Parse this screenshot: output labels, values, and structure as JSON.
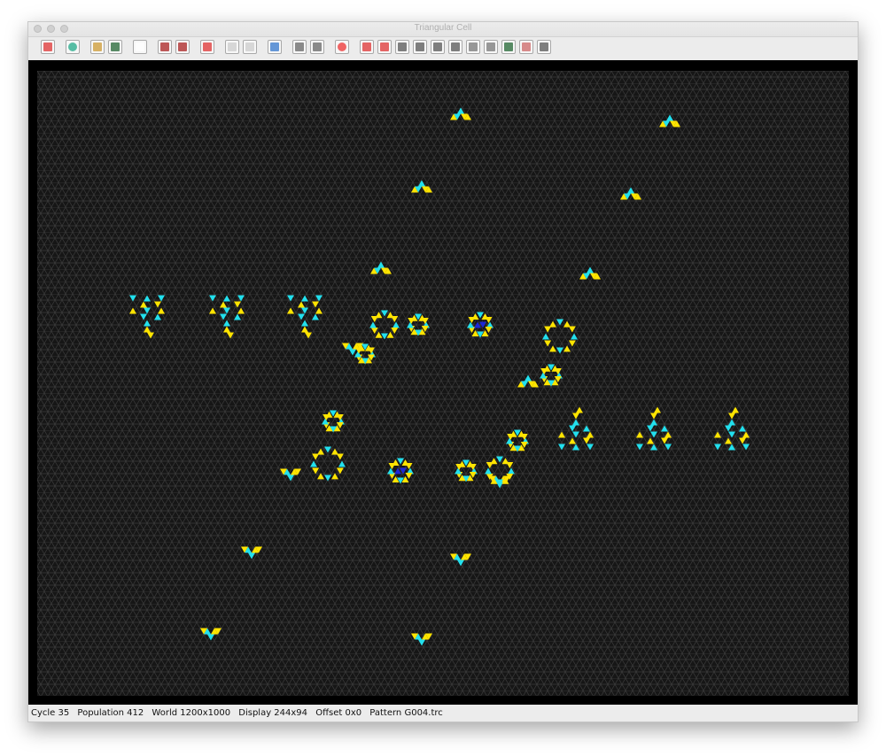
{
  "window": {
    "title": "Triangular Cell"
  },
  "toolbar": {
    "buttons": [
      {
        "icon": "close-red-x-icon"
      },
      {
        "icon": "globe-icon"
      },
      {
        "icon": "open-folder-icon"
      },
      {
        "icon": "save-disk-icon"
      },
      {
        "icon": "new-page-icon"
      },
      {
        "icon": "run-icon"
      },
      {
        "icon": "step-icon"
      },
      {
        "icon": "stop-x-icon"
      },
      {
        "icon": "dice-icon"
      },
      {
        "icon": "grid-icon"
      },
      {
        "icon": "palette-icon"
      },
      {
        "icon": "list-icon"
      },
      {
        "icon": "list-alt-icon"
      },
      {
        "icon": "colors-icon"
      },
      {
        "icon": "clear-x-icon"
      },
      {
        "icon": "clear-alt-icon"
      },
      {
        "icon": "rotate-left-icon"
      },
      {
        "icon": "triangle-flip-icon"
      },
      {
        "icon": "triangle-icon"
      },
      {
        "icon": "triangle-alt-icon"
      },
      {
        "icon": "select-dots-icon"
      },
      {
        "icon": "select-center-icon"
      },
      {
        "icon": "save-green-icon"
      },
      {
        "icon": "pattern-icon"
      },
      {
        "icon": "scissors-icon"
      }
    ]
  },
  "colors": {
    "background": "#000000",
    "grid": "#3a3a3a",
    "yellow": "#ffe400",
    "cyan": "#22e0ee",
    "blue": "#1c28d8"
  },
  "status": {
    "cycle": "Cycle 35",
    "population": "Population 412",
    "world": "World 1200x1000",
    "display": "Display 244x94",
    "offset": "Offset 0x0",
    "pattern": "Pattern G004.trc"
  }
}
